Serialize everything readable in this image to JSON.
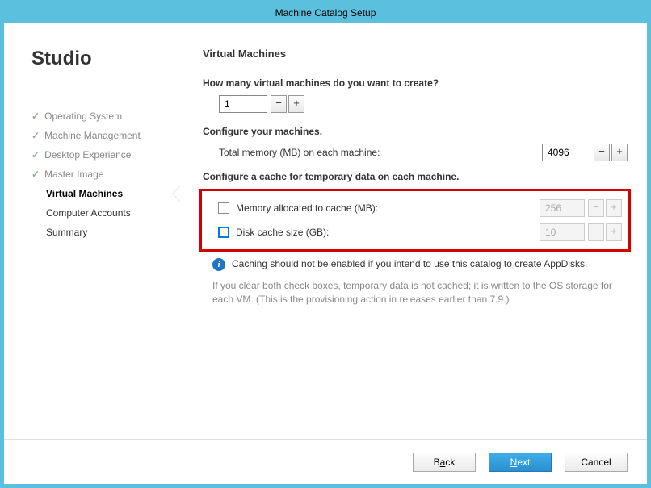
{
  "window": {
    "title": "Machine Catalog Setup"
  },
  "sidebar": {
    "heading": "Studio",
    "items": [
      {
        "label": "Operating System",
        "state": "done"
      },
      {
        "label": "Machine Management",
        "state": "done"
      },
      {
        "label": "Desktop Experience",
        "state": "done"
      },
      {
        "label": "Master Image",
        "state": "done"
      },
      {
        "label": "Virtual Machines",
        "state": "active"
      },
      {
        "label": "Computer Accounts",
        "state": "pending"
      },
      {
        "label": "Summary",
        "state": "pending"
      }
    ]
  },
  "main": {
    "heading": "Virtual Machines",
    "q_count": "How many virtual machines do you want to create?",
    "vm_count": "1",
    "configure_label": "Configure your machines.",
    "total_memory_label": "Total memory (MB) on each machine:",
    "total_memory_value": "4096",
    "cache_heading": "Configure a cache for temporary data on each machine.",
    "cache_mem_label": "Memory allocated to cache (MB):",
    "cache_mem_value": "256",
    "cache_disk_label": "Disk cache size (GB):",
    "cache_disk_value": "10",
    "info_text": "Caching should not be enabled if you intend to use this catalog to create AppDisks.",
    "note_text": "If you clear both check boxes, temporary data is not cached; it is written to the OS storage for each VM. (This is the provisioning action in releases earlier than 7.9.)"
  },
  "footer": {
    "back_pre": "B",
    "back_mn": "a",
    "back_post": "ck",
    "next_pre": "",
    "next_mn": "N",
    "next_post": "ext",
    "cancel": "Cancel"
  },
  "glyphs": {
    "minus": "−",
    "plus": "+",
    "info": "i",
    "check": "✓"
  }
}
